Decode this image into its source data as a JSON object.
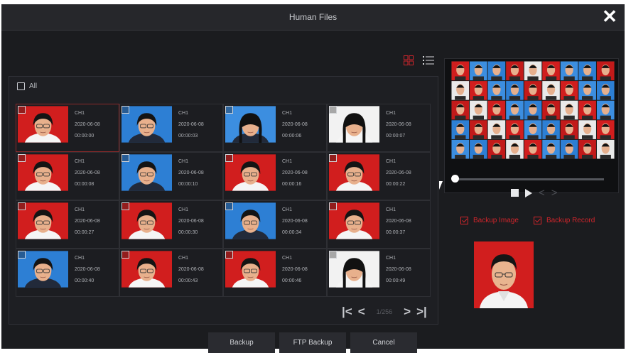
{
  "window": {
    "title": "Human Files"
  },
  "toolbar": {
    "close_icon": "close-icon",
    "grid_view_icon": "grid-view-icon",
    "list_view_icon": "list-view-icon",
    "accent": "#d0252b"
  },
  "panel": {
    "all_label": "All"
  },
  "tiles": [
    {
      "channel": "CH1",
      "date": "2020-06-08",
      "time": "00:00:00",
      "bg": "#d11e1e"
    },
    {
      "channel": "CH1",
      "date": "2020-06-08",
      "time": "00:00:03",
      "bg": "#2d7fd4"
    },
    {
      "channel": "CH1",
      "date": "2020-06-08",
      "time": "00:00:06",
      "bg": "#3c8ee0"
    },
    {
      "channel": "CH1",
      "date": "2020-06-08",
      "time": "00:00:07",
      "bg": "#f2f2f2"
    },
    {
      "channel": "CH1",
      "date": "2020-06-08",
      "time": "00:00:08",
      "bg": "#d11e1e"
    },
    {
      "channel": "CH1",
      "date": "2020-06-08",
      "time": "00:00:10",
      "bg": "#2d7fd4"
    },
    {
      "channel": "CH1",
      "date": "2020-06-08",
      "time": "00:00:16",
      "bg": "#d11e1e"
    },
    {
      "channel": "CH1",
      "date": "2020-06-08",
      "time": "00:00:22",
      "bg": "#d11e1e"
    },
    {
      "channel": "CH1",
      "date": "2020-06-08",
      "time": "00:00:27",
      "bg": "#d11e1e"
    },
    {
      "channel": "CH1",
      "date": "2020-06-08",
      "time": "00:00:30",
      "bg": "#d11e1e"
    },
    {
      "channel": "CH1",
      "date": "2020-06-08",
      "time": "00:00:34",
      "bg": "#2d7fd4"
    },
    {
      "channel": "CH1",
      "date": "2020-06-08",
      "time": "00:00:37",
      "bg": "#d11e1e"
    },
    {
      "channel": "CH1",
      "date": "2020-06-08",
      "time": "00:00:40",
      "bg": "#2d7fd4"
    },
    {
      "channel": "CH1",
      "date": "2020-06-08",
      "time": "00:00:43",
      "bg": "#d11e1e"
    },
    {
      "channel": "CH1",
      "date": "2020-06-08",
      "time": "00:00:46",
      "bg": "#d11e1e"
    },
    {
      "channel": "CH1",
      "date": "2020-06-08",
      "time": "00:00:49",
      "bg": "#f2f2f2"
    }
  ],
  "pagination": {
    "page": "1/256"
  },
  "preview": {
    "progress": 0
  },
  "backup_options": {
    "image": "Backup Image",
    "record": "Backup Record"
  },
  "footer": {
    "backup": "Backup",
    "ftp_backup": "FTP Backup",
    "cancel": "Cancel"
  }
}
